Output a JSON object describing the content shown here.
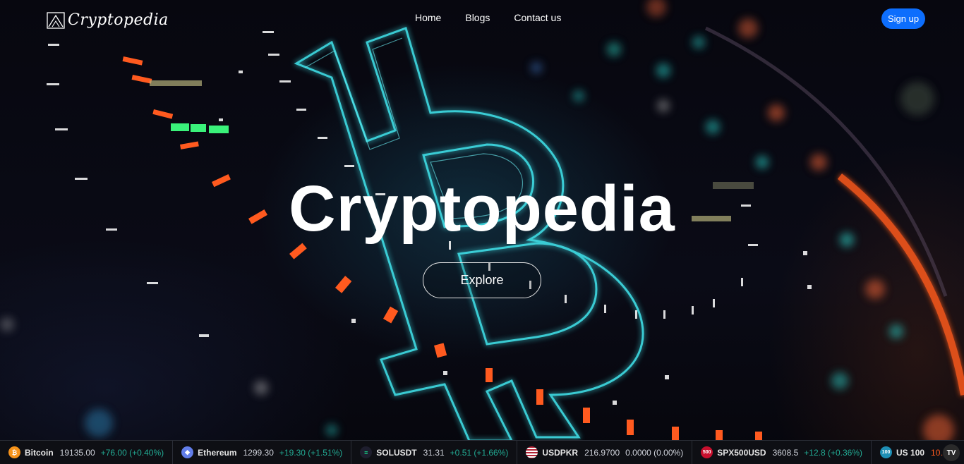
{
  "brand": {
    "name": "Cryptopedia",
    "icon": "triangle-logo-icon"
  },
  "nav": {
    "links": [
      {
        "label": "Home"
      },
      {
        "label": "Blogs"
      },
      {
        "label": "Contact us"
      }
    ],
    "signup_label": "Sign up"
  },
  "hero": {
    "title": "Cryptopedia",
    "explore_label": "Explore"
  },
  "ticker": {
    "items": [
      {
        "name": "Bitcoin",
        "price": "19135.00",
        "change": "+76.00 (+0.40%)",
        "icon": "bitcoin-icon",
        "color": "#f7931a"
      },
      {
        "name": "Ethereum",
        "price": "1299.30",
        "change": "+19.30 (+1.51%)",
        "icon": "ethereum-icon",
        "color": "#627eea"
      },
      {
        "name": "SOLUSDT",
        "price": "31.31",
        "change": "+0.51 (+1.66%)",
        "icon": "solana-icon",
        "color": "#1e1e2e"
      },
      {
        "name": "USDPKR",
        "price": "216.9700",
        "change": "0.0000 (0.00%)",
        "icon": "us-flag-icon",
        "color": "#b22234"
      },
      {
        "name": "SPX500USD",
        "price": "3608.5",
        "change": "+12.8 (+0.36%)",
        "icon": "spx500-icon",
        "color": "#c8102e",
        "badge": "500"
      },
      {
        "name": "US 100",
        "price": "10…",
        "change": "",
        "icon": "us100-icon",
        "color": "#1f8fb5",
        "badge": "100"
      }
    ],
    "provider_icon": "tradingview-icon",
    "provider_badge": "TV",
    "up_color": "#22ab94"
  },
  "colors": {
    "accent": "#0d6efd",
    "glow": "#3fe0e8",
    "orange": "#ff5a1f"
  }
}
